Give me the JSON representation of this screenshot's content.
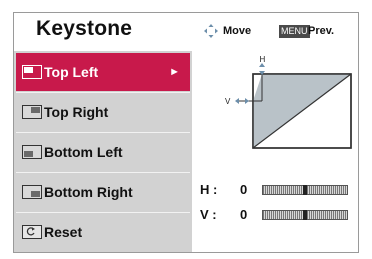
{
  "header": {
    "title": "Keystone",
    "move_icon": "four-way-arrow-icon",
    "move_label": "Move",
    "menu_key": "MENU",
    "prev_label": "Prev."
  },
  "menu": {
    "items": [
      {
        "label": "Top Left",
        "icon": "corner-top-left-icon",
        "selected": true
      },
      {
        "label": "Top Right",
        "icon": "corner-top-right-icon",
        "selected": false
      },
      {
        "label": "Bottom Left",
        "icon": "corner-bottom-left-icon",
        "selected": false
      },
      {
        "label": "Bottom Right",
        "icon": "corner-bottom-right-icon",
        "selected": false
      },
      {
        "label": "Reset",
        "icon": "reset-icon",
        "selected": false
      }
    ],
    "selected_arrow": "►"
  },
  "preview": {
    "h_marker": "H",
    "v_marker": "V",
    "h_label": "H :",
    "h_value": "0",
    "v_label": "V :",
    "v_value": "0",
    "h_level": 0.5,
    "v_level": 0.5
  },
  "colors": {
    "selected": "#c8194b",
    "list_bg": "#d2d2d2",
    "shape_fill": "#b9c2c8"
  }
}
